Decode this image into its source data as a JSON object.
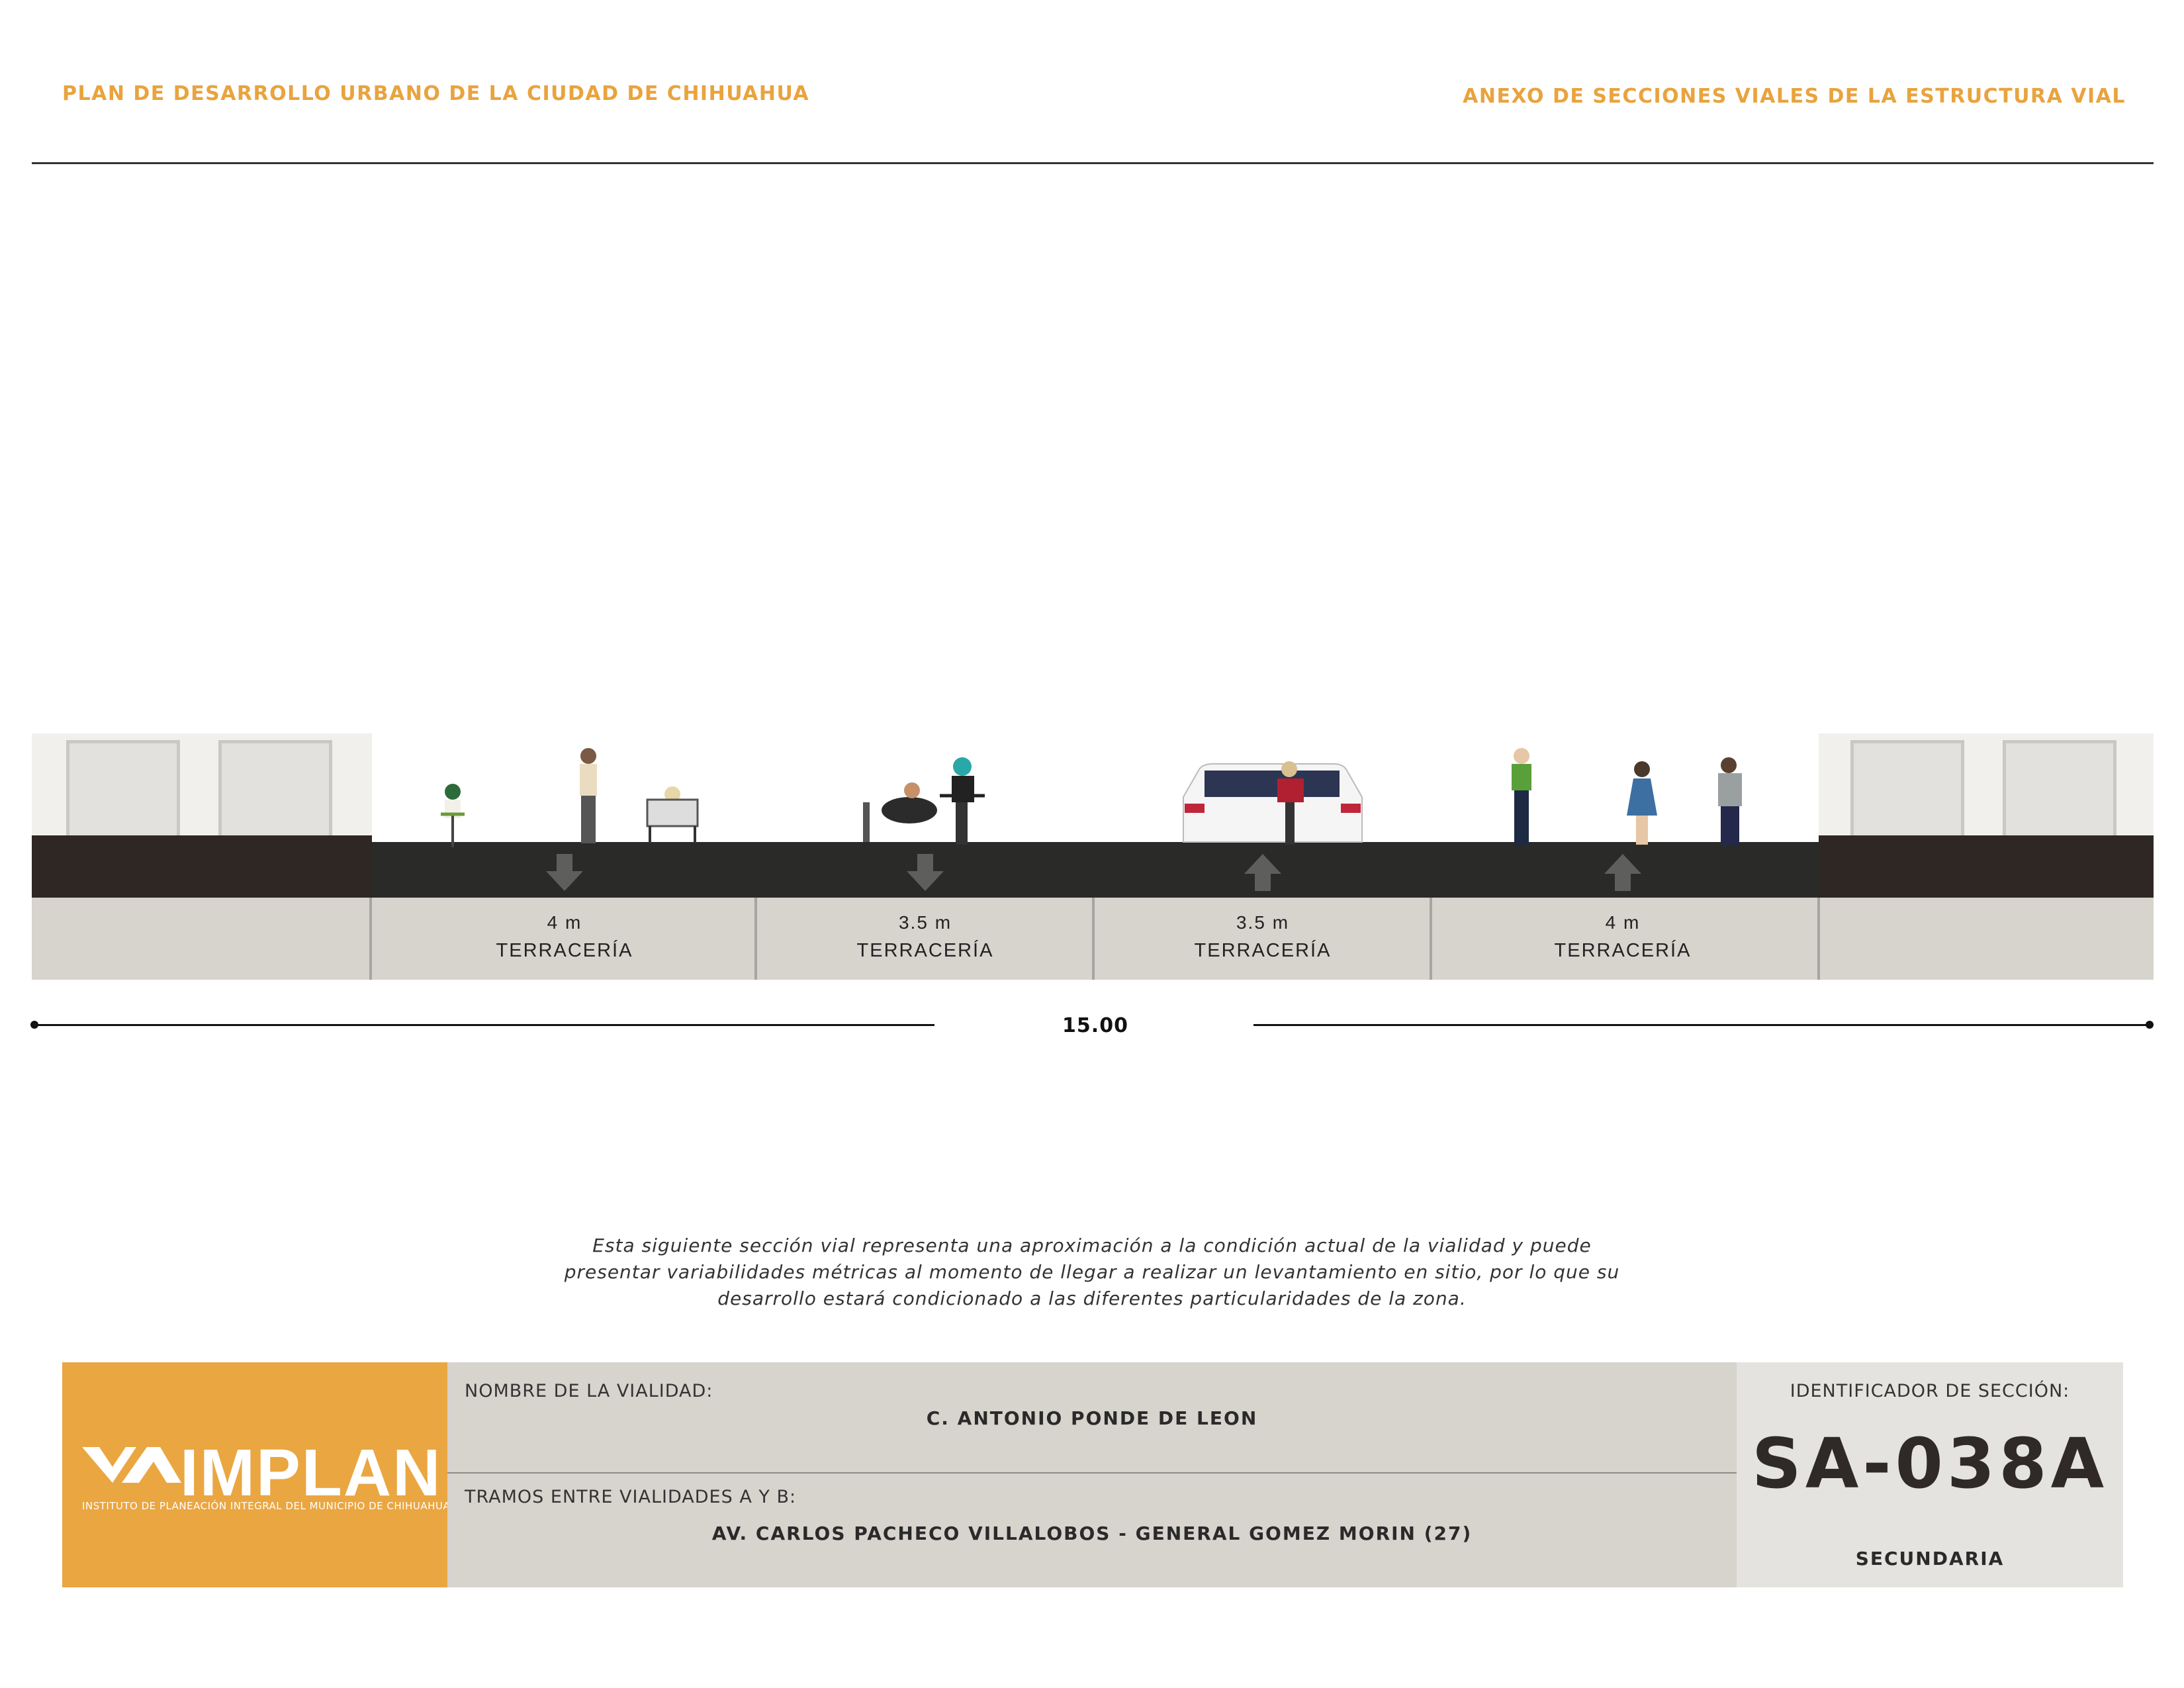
{
  "header": {
    "left_title": "PLAN DE DESARROLLO URBANO DE LA CIUDAD DE CHIHUAHUA",
    "right_title": "ANEXO DE SECCIONES VIALES DE LA ESTRUCTURA VIAL"
  },
  "section": {
    "lanes": [
      {
        "width": "4 m",
        "surface": "TERRACERÍA",
        "direction": "down"
      },
      {
        "width": "3.5 m",
        "surface": "TERRACERÍA",
        "direction": "down"
      },
      {
        "width": "3.5 m",
        "surface": "TERRACERÍA",
        "direction": "up"
      },
      {
        "width": "4 m",
        "surface": "TERRACERÍA",
        "direction": "up"
      }
    ],
    "total_width": "15.00"
  },
  "note": "Esta siguiente sección vial representa una aproximación a la condición actual de la vialidad y puede presentar variabilidades métricas al momento de llegar a realizar un levantamiento en sitio, por lo que su desarrollo estará condicionado a las diferentes particularidades de la zona.",
  "footer": {
    "logo_word": "IMPLAN",
    "logo_subtitle": "INSTITUTO DE PLANEACIÓN INTEGRAL DEL MUNICIPIO DE CHIHUAHUA",
    "street_label": "NOMBRE DE LA VIALIDAD:",
    "street_name": "C. ANTONIO PONDE DE LEON",
    "segment_label": "TRAMOS ENTRE VIALIDADES A Y B:",
    "segment_value": "AV. CARLOS PACHECO VILLALOBOS - GENERAL GOMEZ MORIN (27)",
    "id_label": "IDENTIFICADOR DE SECCIÓN:",
    "id_code": "SA-038A",
    "classification": "SECUNDARIA"
  },
  "colors": {
    "accent": "#e9a33e",
    "roadway": "#2a2b28",
    "sidewalk": "#2e2724",
    "base": "#d7d3cd"
  }
}
